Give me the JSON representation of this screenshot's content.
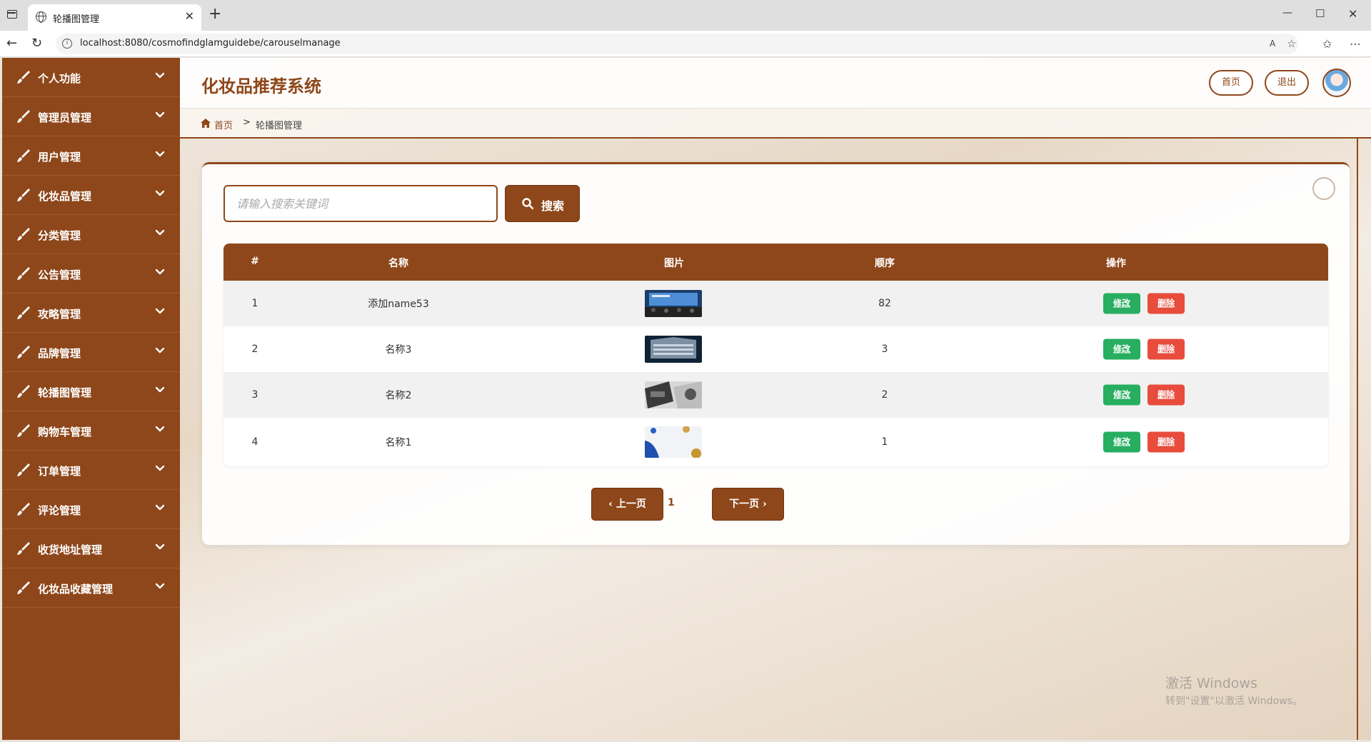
{
  "browser": {
    "tab_title": "轮播图管理",
    "url": "localhost:8080/cosmofindglamguidebe/carouselmanage"
  },
  "sidebar": {
    "items": [
      {
        "label": "个人功能"
      },
      {
        "label": "管理员管理"
      },
      {
        "label": "用户管理"
      },
      {
        "label": "化妆品管理"
      },
      {
        "label": "分类管理"
      },
      {
        "label": "公告管理"
      },
      {
        "label": "攻略管理"
      },
      {
        "label": "品牌管理"
      },
      {
        "label": "轮播图管理"
      },
      {
        "label": "购物车管理"
      },
      {
        "label": "订单管理"
      },
      {
        "label": "评论管理"
      },
      {
        "label": "收货地址管理"
      },
      {
        "label": "化妆品收藏管理"
      }
    ]
  },
  "header": {
    "system_title": "化妆品推荐系统",
    "home_button": "首页",
    "logout_button": "退出"
  },
  "breadcrumb": {
    "home": "首页",
    "separator": ">",
    "current": "轮播图管理"
  },
  "search": {
    "placeholder": "请输入搜索关键词",
    "button_label": "搜索"
  },
  "table": {
    "headers": [
      "#",
      "名称",
      "图片",
      "顺序",
      "操作"
    ],
    "rows": [
      {
        "index": "1",
        "name": "添加name53",
        "image": "conference-thumbnail",
        "order": "82",
        "edit": "修改",
        "delete": "删除"
      },
      {
        "index": "2",
        "name": "名称3",
        "image": "building-thumbnail",
        "order": "3",
        "edit": "修改",
        "delete": "删除"
      },
      {
        "index": "3",
        "name": "名称2",
        "image": "fashion-thumbnail",
        "order": "2",
        "edit": "修改",
        "delete": "删除"
      },
      {
        "index": "4",
        "name": "名称1",
        "image": "abstract-shapes-thumbnail",
        "order": "1",
        "edit": "修改",
        "delete": "删除"
      }
    ]
  },
  "pagination": {
    "prev_label": "上一页",
    "current_page": "1",
    "next_label": "下一页"
  },
  "watermark": {
    "line1": "激活 Windows",
    "line2": "转到\"设置\"以激活 Windows。"
  },
  "colors": {
    "brand": "#8e471a",
    "edit": "#27ae60",
    "delete": "#e74c3c"
  }
}
